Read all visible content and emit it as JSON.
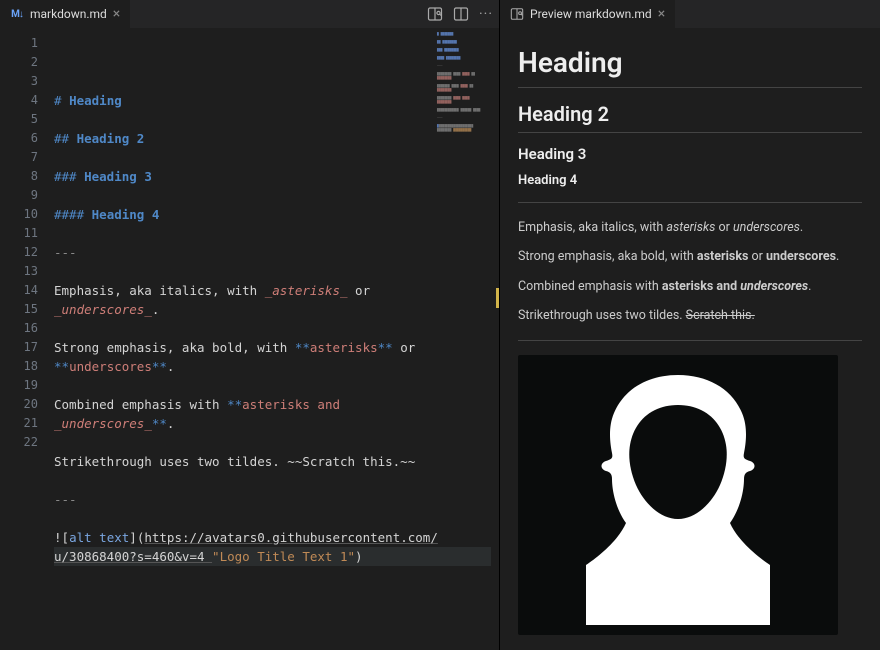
{
  "editor": {
    "tab": {
      "label": "markdown.md"
    },
    "lines": [
      {
        "n": 1,
        "seg": [
          {
            "t": "# ",
            "c": "tok-hash"
          },
          {
            "t": "Heading",
            "c": "tok-head"
          }
        ]
      },
      {
        "n": 2,
        "seg": []
      },
      {
        "n": 3,
        "seg": [
          {
            "t": "## ",
            "c": "tok-hash"
          },
          {
            "t": "Heading 2",
            "c": "tok-head"
          }
        ]
      },
      {
        "n": 4,
        "seg": []
      },
      {
        "n": 5,
        "seg": [
          {
            "t": "### ",
            "c": "tok-hash"
          },
          {
            "t": "Heading 3",
            "c": "tok-head"
          }
        ]
      },
      {
        "n": 6,
        "seg": []
      },
      {
        "n": 7,
        "seg": [
          {
            "t": "#### ",
            "c": "tok-hash"
          },
          {
            "t": "Heading 4",
            "c": "tok-head"
          }
        ]
      },
      {
        "n": 8,
        "seg": []
      },
      {
        "n": 9,
        "seg": [
          {
            "t": "---",
            "c": "tok-dash"
          }
        ]
      },
      {
        "n": 10,
        "seg": []
      },
      {
        "n": 11,
        "seg": [
          {
            "t": "Emphasis, aka italics, with ",
            "c": ""
          },
          {
            "t": "_",
            "c": "tok-emred"
          },
          {
            "t": "asterisks",
            "c": "tok-emital"
          },
          {
            "t": "_",
            "c": "tok-emred"
          },
          {
            "t": " or",
            "c": ""
          }
        ]
      },
      {
        "n": "",
        "seg": [
          {
            "t": "_",
            "c": "tok-emred"
          },
          {
            "t": "underscores",
            "c": "tok-emital"
          },
          {
            "t": "_",
            "c": "tok-emred"
          },
          {
            "t": ".",
            "c": ""
          }
        ]
      },
      {
        "n": 12,
        "seg": []
      },
      {
        "n": 13,
        "seg": [
          {
            "t": "Strong emphasis, aka bold, with ",
            "c": ""
          },
          {
            "t": "**",
            "c": "tok-star"
          },
          {
            "t": "asterisks",
            "c": "tok-emred"
          },
          {
            "t": "**",
            "c": "tok-star"
          },
          {
            "t": " or",
            "c": ""
          }
        ]
      },
      {
        "n": "",
        "seg": [
          {
            "t": "**",
            "c": "tok-star"
          },
          {
            "t": "underscores",
            "c": "tok-emred"
          },
          {
            "t": "**",
            "c": "tok-star"
          },
          {
            "t": ".",
            "c": ""
          }
        ]
      },
      {
        "n": 14,
        "seg": []
      },
      {
        "n": 15,
        "seg": [
          {
            "t": "Combined emphasis with ",
            "c": ""
          },
          {
            "t": "**",
            "c": "tok-star"
          },
          {
            "t": "asterisks and",
            "c": "tok-emred"
          }
        ]
      },
      {
        "n": "",
        "seg": [
          {
            "t": "_",
            "c": "tok-emred"
          },
          {
            "t": "underscores",
            "c": "tok-emital"
          },
          {
            "t": "_",
            "c": "tok-emred"
          },
          {
            "t": "**",
            "c": "tok-star"
          },
          {
            "t": ".",
            "c": ""
          }
        ]
      },
      {
        "n": 16,
        "seg": []
      },
      {
        "n": 17,
        "seg": [
          {
            "t": "Strikethrough uses two tildes. ~~Scratch this.~~",
            "c": ""
          }
        ]
      },
      {
        "n": 18,
        "seg": []
      },
      {
        "n": 19,
        "seg": [
          {
            "t": "---",
            "c": "tok-dash"
          }
        ]
      },
      {
        "n": 20,
        "seg": []
      },
      {
        "n": 21,
        "seg": [
          {
            "t": "!",
            "c": "tok-bracket"
          },
          {
            "t": "[",
            "c": "tok-bracket"
          },
          {
            "t": "alt text",
            "c": "tok-alt"
          },
          {
            "t": "]",
            "c": "tok-bracket"
          },
          {
            "t": "(",
            "c": "tok-bracket"
          },
          {
            "t": "https://avatars0.githubusercontent.com/",
            "c": "tok-url"
          }
        ],
        "cursor": false
      },
      {
        "n": "",
        "seg": [
          {
            "t": "u/30868400?s=460&v=4 ",
            "c": "tok-url"
          },
          {
            "t": "\"Logo Title Text 1\"",
            "c": "tok-string"
          },
          {
            "t": ")",
            "c": "tok-bracket"
          }
        ],
        "cursor": true
      },
      {
        "n": 22,
        "seg": []
      }
    ]
  },
  "preview": {
    "tab": {
      "label": "Preview markdown.md"
    },
    "h1": "Heading",
    "h2": "Heading 2",
    "h3": "Heading 3",
    "h4": "Heading 4",
    "p1": {
      "pre": "Emphasis, aka italics, with ",
      "em1": "asterisks",
      "mid": " or ",
      "em2": "underscores",
      "post": "."
    },
    "p2": {
      "pre": "Strong emphasis, aka bold, with ",
      "b1": "asterisks",
      "mid": " or ",
      "b2": "underscores",
      "post": "."
    },
    "p3": {
      "pre": "Combined emphasis with ",
      "b": "asterisks and ",
      "bi": "underscores",
      "post": "."
    },
    "p4": {
      "pre": "Strikethrough uses two tildes. ",
      "s": "Scratch this."
    }
  }
}
